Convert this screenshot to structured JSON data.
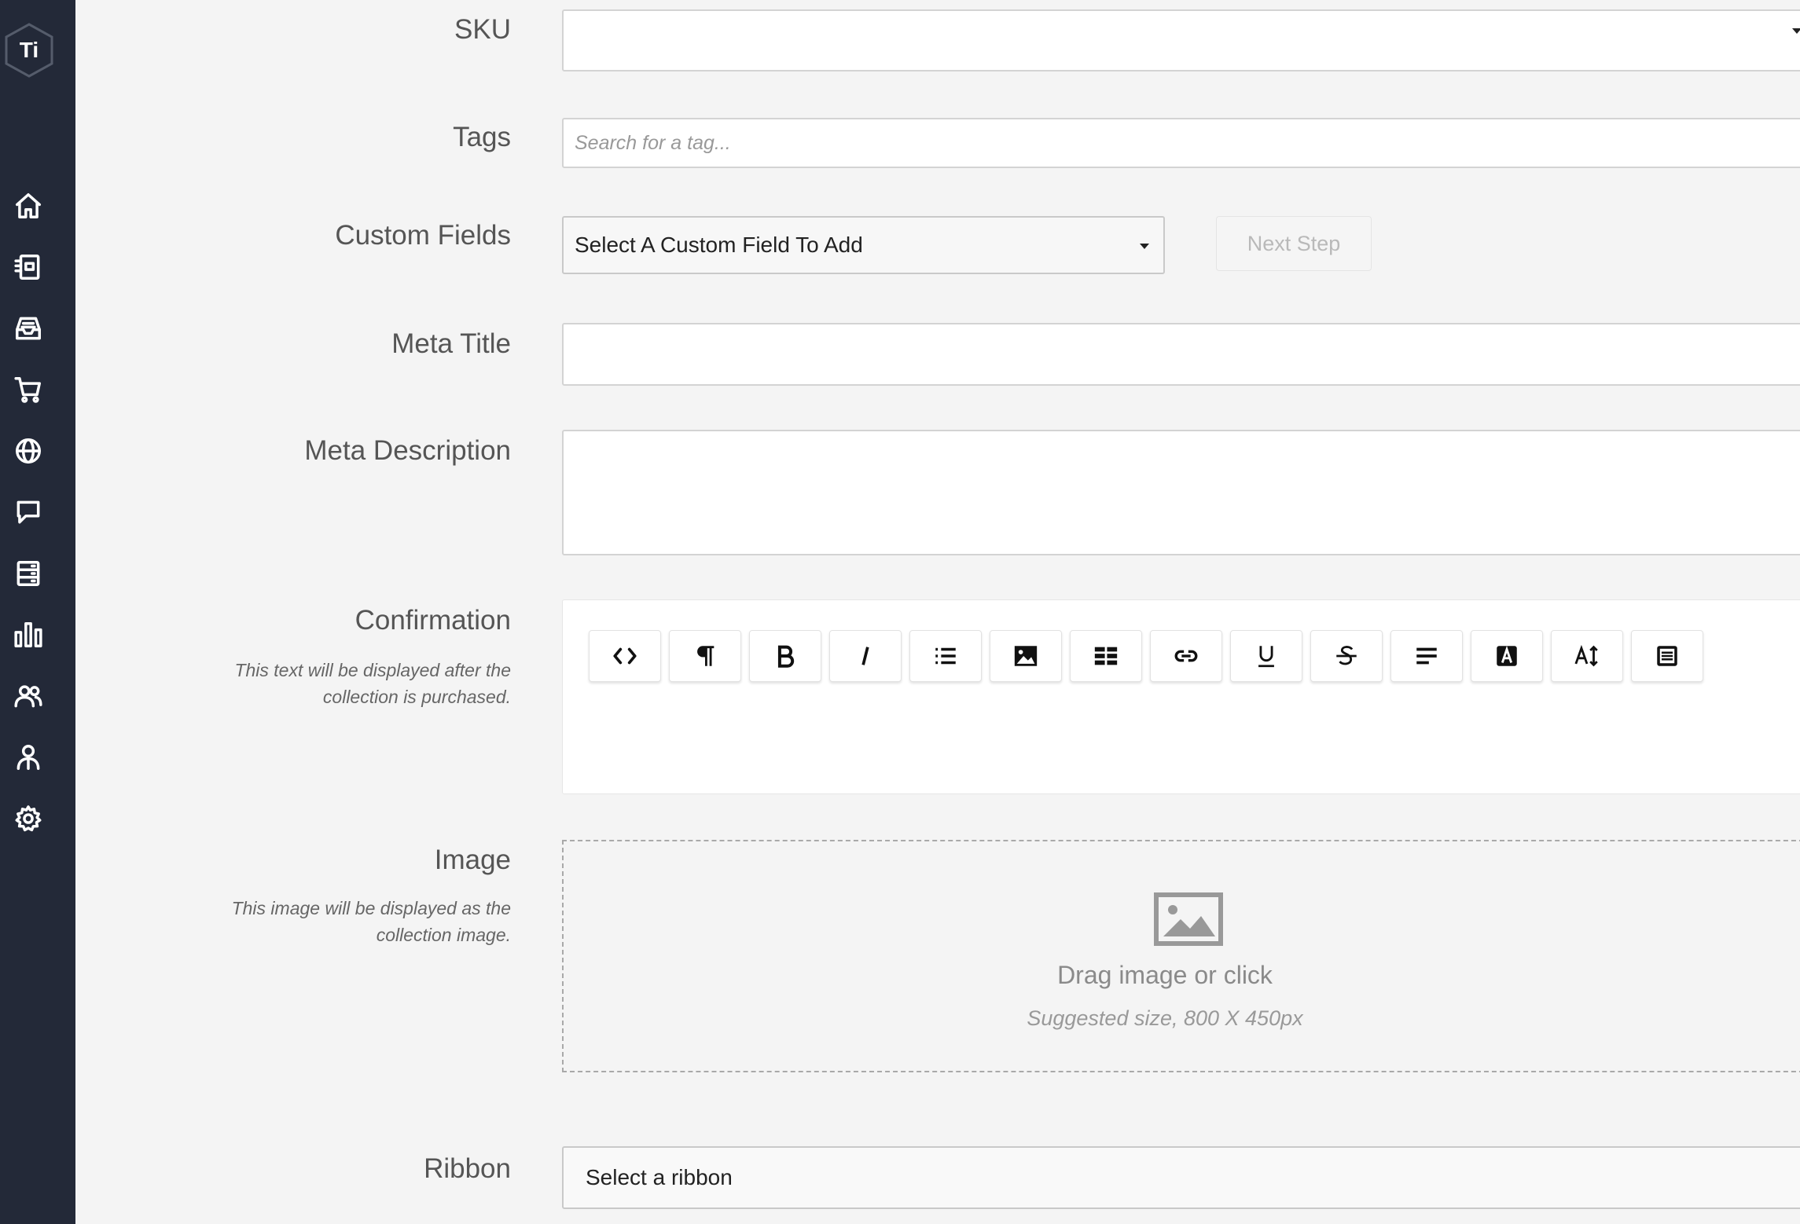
{
  "sidebar": {
    "logo_text": "Ti",
    "items": [
      {
        "icon": "home-icon"
      },
      {
        "icon": "receipt-icon"
      },
      {
        "icon": "inbox-icon"
      },
      {
        "icon": "cart-icon"
      },
      {
        "icon": "globe-icon"
      },
      {
        "icon": "chat-icon"
      },
      {
        "icon": "document-list-icon"
      },
      {
        "icon": "bar-chart-icon"
      },
      {
        "icon": "users-icon"
      },
      {
        "icon": "user-network-icon"
      },
      {
        "icon": "gear-icon"
      }
    ]
  },
  "form": {
    "sku": {
      "label": "SKU",
      "value": ""
    },
    "tags": {
      "label": "Tags",
      "placeholder": "Search for a tag..."
    },
    "custom_fields": {
      "label": "Custom Fields",
      "select_value": "Select A Custom Field To Add",
      "next_button": "Next Step"
    },
    "meta_title": {
      "label": "Meta Title",
      "value": ""
    },
    "meta_description": {
      "label": "Meta Description",
      "value": ""
    },
    "confirmation": {
      "label": "Confirmation",
      "hint": "This text will be displayed after the collection is purchased.",
      "toolbar": [
        "code-view",
        "paragraph",
        "bold",
        "italic",
        "list",
        "image",
        "table",
        "link",
        "underline",
        "strikethrough",
        "align",
        "font-color",
        "font-size",
        "document"
      ]
    },
    "image": {
      "label": "Image",
      "hint": "This image will be displayed as the collection image.",
      "drop_title": "Drag image or click",
      "drop_subtitle": "Suggested size, 800 X 450px"
    },
    "ribbon": {
      "label": "Ribbon",
      "select_value": "Select a ribbon"
    }
  }
}
